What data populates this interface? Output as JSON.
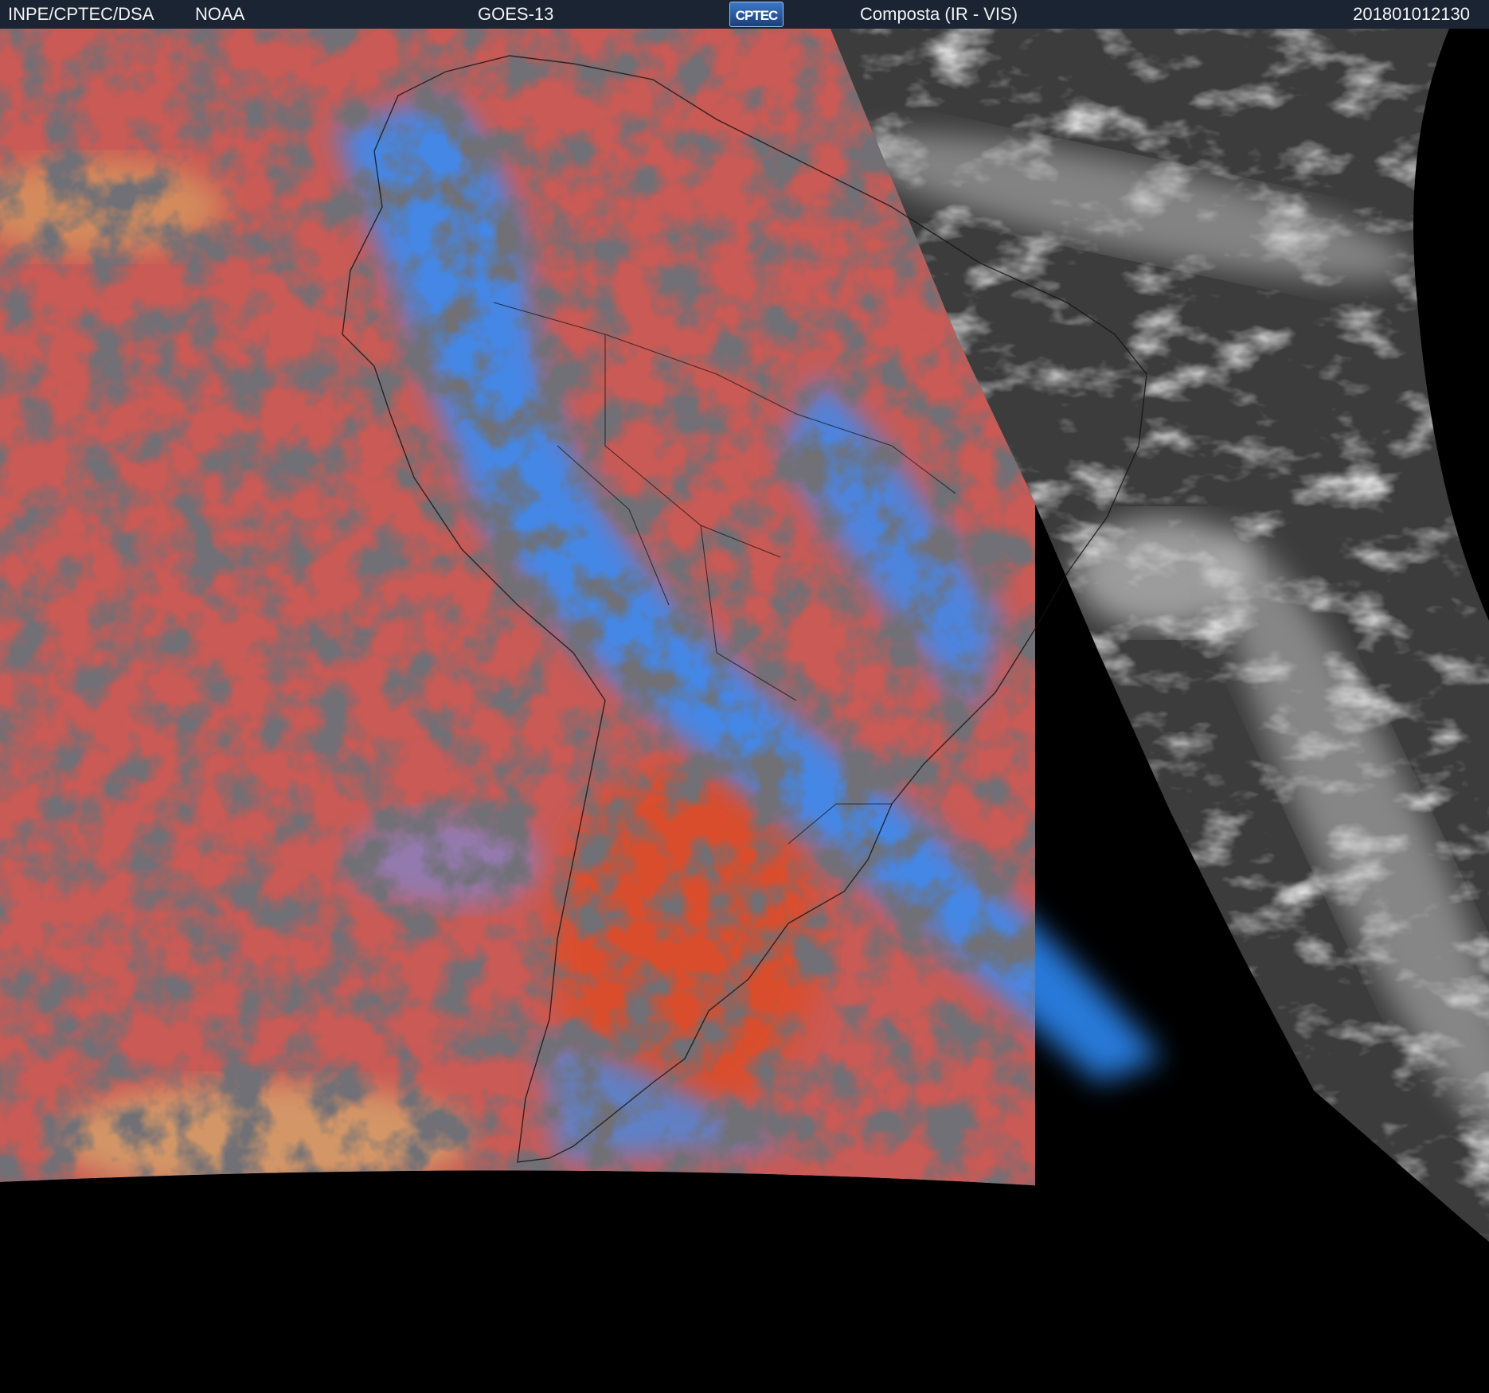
{
  "header": {
    "institution": "INPE/CPTEC/DSA",
    "agency": "NOAA",
    "satellite": "GOES-13",
    "logo_text": "CPTEC",
    "product": "Composta (IR - VIS)",
    "timestamp": "201801012130"
  },
  "colors": {
    "header_bg": "#1a2433",
    "ir_warm": "#c95a55",
    "ir_orange": "#dd4b26",
    "cold_cloud_blue": "#2e8fff",
    "clear_dark": "#2c2b2e",
    "vis_gray": "#3c3c3c",
    "vis_cloud": "#d8d8d8",
    "space": "#000000"
  }
}
